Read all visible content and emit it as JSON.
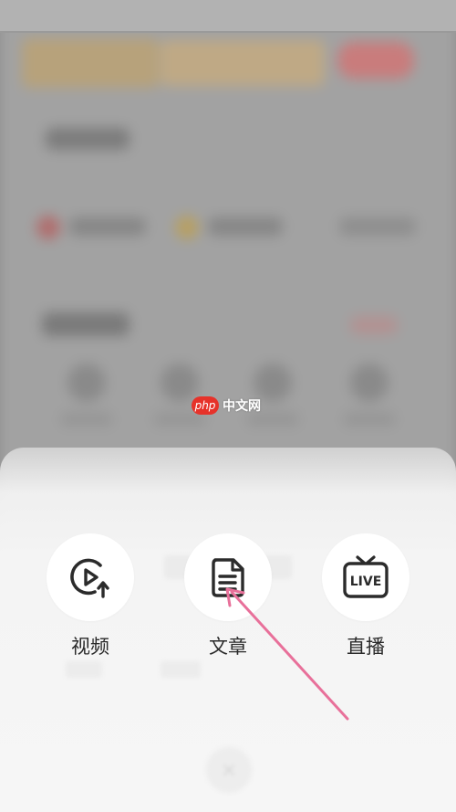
{
  "watermark": {
    "badge": "php",
    "site": "中文网"
  },
  "publish_sheet": {
    "options": [
      {
        "id": "video",
        "label": "视频",
        "icon": "video-upload-icon"
      },
      {
        "id": "article",
        "label": "文章",
        "icon": "document-icon"
      },
      {
        "id": "live",
        "label": "直播",
        "icon": "live-tv-icon"
      }
    ],
    "live_icon_text": "LIVE"
  },
  "colors": {
    "accent_arrow": "#e8709a",
    "icon_stroke": "#2b2b2b",
    "sheet_bg": "#f6f6f6",
    "watermark_red": "#e6322a"
  }
}
